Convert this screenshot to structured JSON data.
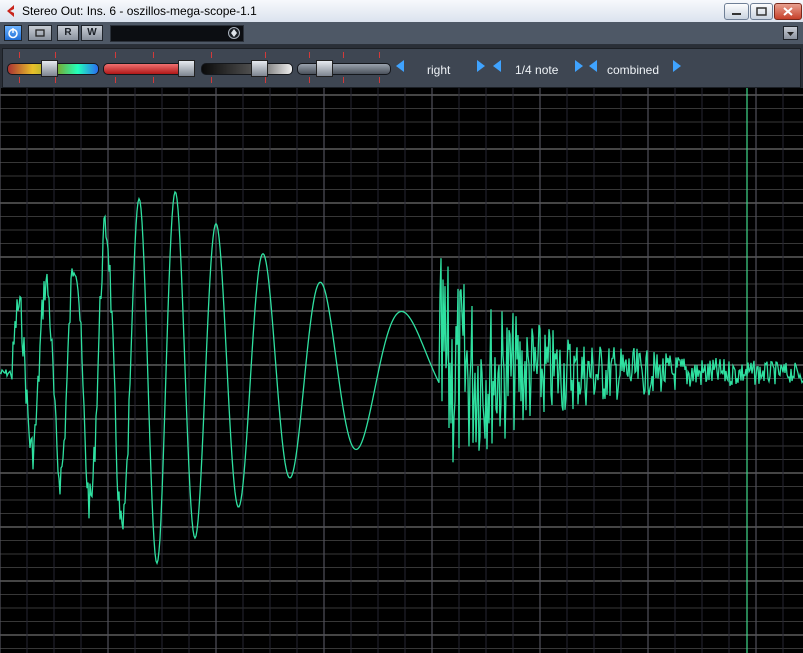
{
  "window": {
    "title": "Stereo Out: Ins. 6 - oszillos-mega-scope-1.1"
  },
  "toolbar": {
    "r_label": "R",
    "w_label": "W"
  },
  "controls": {
    "channel": "right",
    "time_division": "1/4 note",
    "mode": "combined"
  },
  "colors": {
    "trace": "#2fe0a0",
    "grid": "#6a6a6a",
    "cursor": "#3fd98a",
    "background": "#000000"
  },
  "icons": [
    "app-icon",
    "power-icon",
    "bypass-icon",
    "minimize-icon",
    "maximize-icon",
    "close-icon",
    "settings-icon",
    "dropdown-arrow-icon"
  ]
}
